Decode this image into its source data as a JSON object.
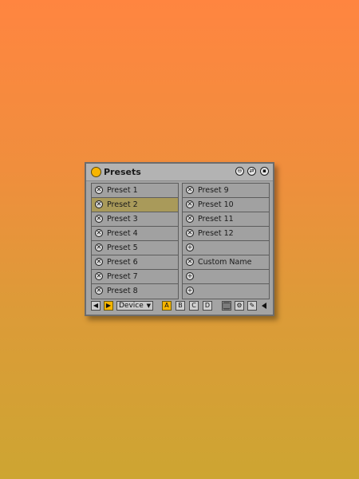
{
  "device": {
    "title": "Presets",
    "header_icons": [
      "fold-icon",
      "hotswap-icon",
      "save-icon"
    ]
  },
  "presets_left": [
    {
      "label": "Preset 1",
      "icon": "✕",
      "selected": false
    },
    {
      "label": "Preset 2",
      "icon": "✕",
      "selected": true
    },
    {
      "label": "Preset 3",
      "icon": "✕",
      "selected": false
    },
    {
      "label": "Preset 4",
      "icon": "✕",
      "selected": false
    },
    {
      "label": "Preset 5",
      "icon": "✕",
      "selected": false
    },
    {
      "label": "Preset 6",
      "icon": "✕",
      "selected": false
    },
    {
      "label": "Preset 7",
      "icon": "✕",
      "selected": false
    },
    {
      "label": "Preset 8",
      "icon": "✕",
      "selected": false
    }
  ],
  "presets_right": [
    {
      "label": "Preset 9",
      "icon": "✕"
    },
    {
      "label": "Preset 10",
      "icon": "✕"
    },
    {
      "label": "Preset 11",
      "icon": "✕"
    },
    {
      "label": "Preset 12",
      "icon": "✕"
    },
    {
      "label": "",
      "icon": "+"
    },
    {
      "label": "Custom Name",
      "icon": "✕"
    },
    {
      "label": "",
      "icon": "+"
    },
    {
      "label": "",
      "icon": "+"
    }
  ],
  "bottom": {
    "prev": "◀",
    "next": "▶",
    "scope_value": "Device",
    "scope_arrow": "▼",
    "banks": [
      "A",
      "B",
      "C",
      "D"
    ],
    "active_bank": "A"
  },
  "colors": {
    "accent": "#f7b500",
    "selected_row": "#a99a5a",
    "panel": "#a4a4a4"
  }
}
